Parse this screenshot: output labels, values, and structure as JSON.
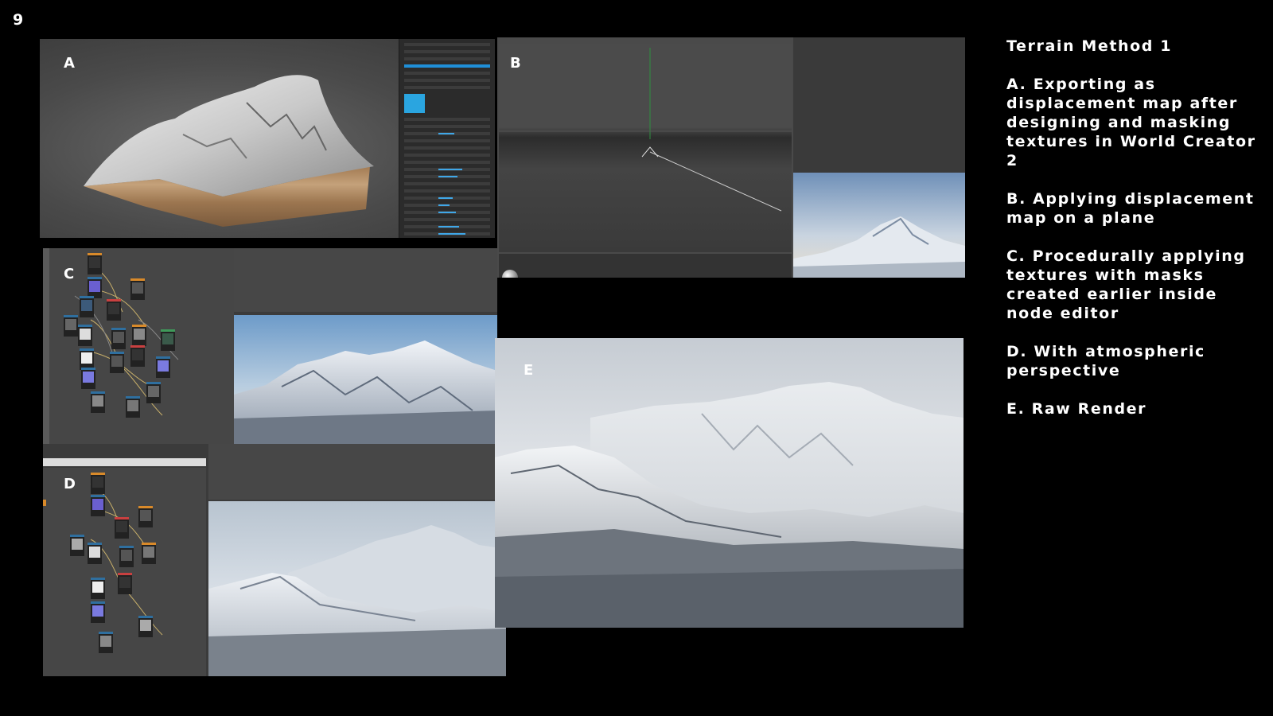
{
  "page_number": "9",
  "panels": {
    "a": {
      "letter": "A"
    },
    "b": {
      "letter": "B"
    },
    "c": {
      "letter": "C"
    },
    "d": {
      "letter": "D"
    },
    "e": {
      "letter": "E"
    }
  },
  "text": {
    "title": "Terrain Method 1",
    "items": [
      "A. Exporting as displacement map after designing and masking textures in World Creator 2",
      "B. Applying displacement map on a plane",
      "C. Procedurally applying textures with masks created earlier inside node editor",
      "D. With atmospheric perspective",
      "E. Raw Render"
    ]
  },
  "colors": {
    "background": "#000000",
    "text": "#ffffff",
    "ui_dark": "#2b2b2b",
    "ui_accent": "#1f8fd8"
  }
}
